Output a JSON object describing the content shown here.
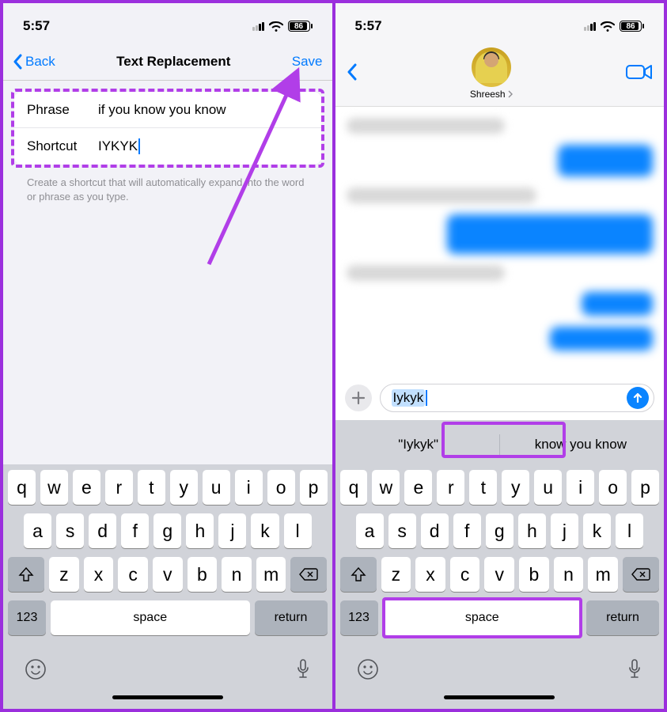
{
  "status": {
    "time": "5:57",
    "battery": "86"
  },
  "left": {
    "back": "Back",
    "title": "Text Replacement",
    "save": "Save",
    "phrase_label": "Phrase",
    "phrase_value": "if you know you know",
    "shortcut_label": "Shortcut",
    "shortcut_value": "IYKYK",
    "helper": "Create a shortcut that will automatically expand into the word or phrase as you type."
  },
  "right": {
    "contact": "Shreesh",
    "compose_text": "Iykyk",
    "suggest1": "\"Iykyk\"",
    "suggest2": "know you know"
  },
  "keyboard": {
    "row1": [
      "q",
      "w",
      "e",
      "r",
      "t",
      "y",
      "u",
      "i",
      "o",
      "p"
    ],
    "row2": [
      "a",
      "s",
      "d",
      "f",
      "g",
      "h",
      "j",
      "k",
      "l"
    ],
    "row3": [
      "z",
      "x",
      "c",
      "v",
      "b",
      "n",
      "m"
    ],
    "num": "123",
    "space": "space",
    "return": "return"
  }
}
